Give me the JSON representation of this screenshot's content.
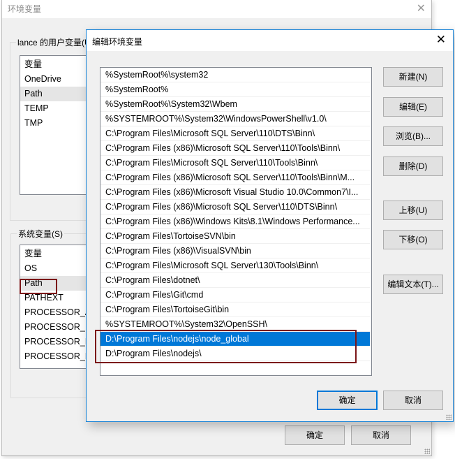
{
  "background_window": {
    "title": "环境变量",
    "user_vars_group_label": "lance 的用户变量(U)",
    "user_vars": {
      "header": "变量",
      "items": [
        "OneDrive",
        "Path",
        "TEMP",
        "TMP"
      ],
      "selected": "Path"
    },
    "system_vars_group_label": "系统变量(S)",
    "system_vars": {
      "header": "变量",
      "items": [
        "OS",
        "Path",
        "PATHEXT",
        "PROCESSOR_ARCHITECTURE",
        "PROCESSOR_IDENTIFIER",
        "PROCESSOR_LEVEL",
        "PROCESSOR_REVISION"
      ],
      "selected": "Path"
    },
    "ok_label": "确定",
    "cancel_label": "取消"
  },
  "dialog": {
    "title": "编辑环境变量",
    "paths": [
      "%SystemRoot%\\system32",
      "%SystemRoot%",
      "%SystemRoot%\\System32\\Wbem",
      "%SYSTEMROOT%\\System32\\WindowsPowerShell\\v1.0\\",
      "C:\\Program Files\\Microsoft SQL Server\\110\\DTS\\Binn\\",
      "C:\\Program Files (x86)\\Microsoft SQL Server\\110\\Tools\\Binn\\",
      "C:\\Program Files\\Microsoft SQL Server\\110\\Tools\\Binn\\",
      "C:\\Program Files (x86)\\Microsoft SQL Server\\110\\Tools\\Binn\\M...",
      "C:\\Program Files (x86)\\Microsoft Visual Studio 10.0\\Common7\\I...",
      "C:\\Program Files (x86)\\Microsoft SQL Server\\110\\DTS\\Binn\\",
      "C:\\Program Files (x86)\\Windows Kits\\8.1\\Windows Performance...",
      "C:\\Program Files\\TortoiseSVN\\bin",
      "C:\\Program Files (x86)\\VisualSVN\\bin",
      "C:\\Program Files\\Microsoft SQL Server\\130\\Tools\\Binn\\",
      "C:\\Program Files\\dotnet\\",
      "C:\\Program Files\\Git\\cmd",
      "C:\\Program Files\\TortoiseGit\\bin",
      "%SYSTEMROOT%\\System32\\OpenSSH\\",
      "D:\\Program Files\\nodejs\\node_global",
      "D:\\Program Files\\nodejs\\"
    ],
    "selected_index": 18,
    "buttons": {
      "new": "新建(N)",
      "edit": "编辑(E)",
      "browse": "浏览(B)...",
      "delete": "删除(D)",
      "move_up": "上移(U)",
      "move_down": "下移(O)",
      "edit_text": "编辑文本(T)..."
    },
    "ok_label": "确定",
    "cancel_label": "取消"
  },
  "colors": {
    "selection": "#0078d7",
    "highlight_annotation": "#7b1518",
    "dialog_border": "#1883d7"
  }
}
